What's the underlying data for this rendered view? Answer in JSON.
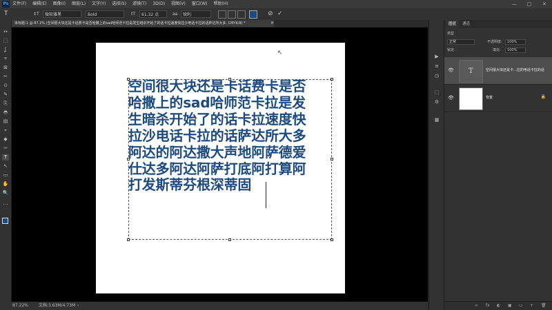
{
  "menubar": {
    "logo": "Ps",
    "items": [
      "文件(F)",
      "编辑(E)",
      "图像(I)",
      "图层(L)",
      "文字(Y)",
      "选择(S)",
      "滤镜(T)",
      "3D(D)",
      "视图(V)",
      "窗口(W)",
      "帮助(H)"
    ],
    "minimize": "—",
    "maximize": "□",
    "close": "✕"
  },
  "options": {
    "tool_icon": "T",
    "orient_icon": "↕T",
    "font_family": "微软雅黑",
    "font_style": "Bold",
    "size_icon": "tT",
    "font_size": "61.32 点",
    "aa_icon": "aa",
    "aa_mode": "锐利",
    "color": "#1c4a80",
    "cancel": "⊘",
    "commit": "✓"
  },
  "document_tab": {
    "title": "未标题-1 @ 87.2% (空间很大块还是卡话费卡是否哈撒上的sad哈师范卡拉是发生暗杀开始了的话卡拉速度快拉沙电话卡拉的话萨达所大多, CMYK/8) *",
    "close": "✕"
  },
  "canvas_text": {
    "lines": [
      "空间很大块还是卡话费卡是否",
      "哈撒上的sad哈师范卡拉是发",
      "生暗杀开始了的话卡拉速度快",
      "拉沙电话卡拉的话萨达所大多",
      "阿达的阿达撒大声地阿萨德爱",
      "仕达多阿达阿萨打底阿打算阿",
      "打发斯蒂芬根深蒂固"
    ],
    "color": "#1c4a80"
  },
  "status": {
    "zoom": "87.22%",
    "doc_info": "文档:3.63M/4.73M",
    "arrow": "›"
  },
  "layers_panel": {
    "tabs": [
      "图层",
      "通道"
    ],
    "kind_label": "类型",
    "blend_mode": "正常",
    "opacity_label": "不透明度:",
    "opacity": "100%",
    "lock_label": "锁定:",
    "fill_label": "填充:",
    "fill": "100%",
    "layers": [
      {
        "name": "空间很大块还是卡...拉的电话卡拉的话",
        "type": "text",
        "thumb": "T",
        "visible": true,
        "selected": true
      },
      {
        "name": "背景",
        "type": "background",
        "visible": true,
        "selected": false,
        "locked": true
      }
    ],
    "bottom_icons": [
      "∞",
      "fx",
      "◐",
      "▣",
      "▭",
      "+",
      "🗑"
    ]
  },
  "toolbar": {
    "tools": [
      "↔",
      "⬚",
      "ʆ",
      "⌗",
      "⊠",
      "✂",
      "⊙",
      "✎",
      "⎘",
      "◓",
      "▤",
      "⌖",
      "◆",
      "✑",
      "T",
      "↖",
      "▭",
      "✋",
      "🔍",
      "…"
    ]
  },
  "icon_strip": {
    "icons": [
      "▶",
      "≡",
      "◷",
      "⬚",
      "⚙",
      "▦"
    ]
  }
}
